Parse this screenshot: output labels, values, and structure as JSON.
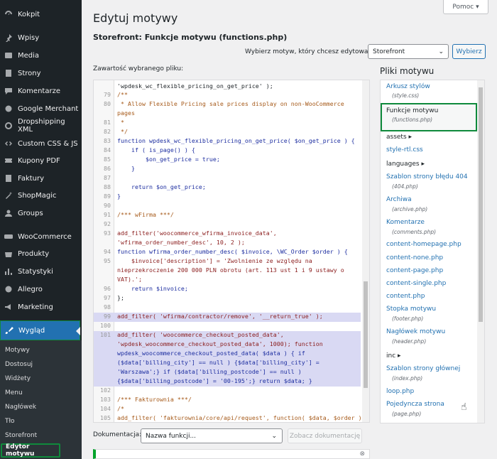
{
  "sidebar": {
    "items": [
      {
        "label": "Kokpit",
        "icon": "dashboard-icon"
      },
      {
        "label": "Wpisy",
        "icon": "pin-icon"
      },
      {
        "label": "Media",
        "icon": "media-icon"
      },
      {
        "label": "Strony",
        "icon": "page-icon"
      },
      {
        "label": "Komentarze",
        "icon": "comment-icon"
      },
      {
        "label": "Google Merchant",
        "icon": "google-merchant-icon"
      },
      {
        "label": "Dropshipping XML",
        "icon": "dropshipping-icon"
      },
      {
        "label": "Custom CSS & JS",
        "icon": "code-icon"
      },
      {
        "label": "Kupony PDF",
        "icon": "coupon-icon"
      },
      {
        "label": "Faktury",
        "icon": "invoice-icon"
      },
      {
        "label": "ShopMagic",
        "icon": "magic-icon"
      },
      {
        "label": "Groups",
        "icon": "groups-icon"
      },
      {
        "label": "WooCommerce",
        "icon": "woocommerce-icon"
      },
      {
        "label": "Produkty",
        "icon": "product-icon"
      },
      {
        "label": "Statystyki",
        "icon": "stats-icon"
      },
      {
        "label": "Allegro",
        "icon": "allegro-icon"
      },
      {
        "label": "Marketing",
        "icon": "marketing-icon"
      }
    ],
    "active": {
      "label": "Wygląd",
      "icon": "brush-icon"
    },
    "submenu": [
      "Motywy",
      "Dostosuj",
      "Widżety",
      "Menu",
      "Nagłówek",
      "Tło",
      "Storefront"
    ],
    "submenu_active": "Edytor motywu"
  },
  "header": {
    "help": "Pomoc",
    "title": "Edytuj motywy",
    "subtitle": "Storefront: Funkcje motywu (functions.php)",
    "choose_label": "Wybierz motyw, który chcesz edytować:",
    "theme_value": "Storefront",
    "choose_button": "Wybierz",
    "file_label": "Zawartość wybranego pliku:"
  },
  "editor": {
    "lines": [
      {
        "num": "",
        "code": "'wpdesk_wc_flexible_pricing_on_get_price' );"
      },
      {
        "num": "79",
        "code": "/**"
      },
      {
        "num": "80",
        "code": " * Allow Flexible Pricing sale prices display on non-WooCommerce"
      },
      {
        "num": "",
        "code": "pages"
      },
      {
        "num": "81",
        "code": " *"
      },
      {
        "num": "82",
        "code": " */"
      },
      {
        "num": "83",
        "code": "function wpdesk_wc_flexible_pricing_on_get_price( $on_get_price ) {"
      },
      {
        "num": "84",
        "code": "    if ( is_page() ) {"
      },
      {
        "num": "85",
        "code": "        $on_get_price = true;"
      },
      {
        "num": "86",
        "code": "    }"
      },
      {
        "num": "87",
        "code": ""
      },
      {
        "num": "88",
        "code": "    return $on_get_price;"
      },
      {
        "num": "89",
        "code": "}"
      },
      {
        "num": "90",
        "code": ""
      },
      {
        "num": "91",
        "code": "/*** wFirma ***/"
      },
      {
        "num": "92",
        "code": ""
      },
      {
        "num": "93",
        "code": "add_filter('woocommerce_wfirma_invoice_data',"
      },
      {
        "num": "",
        "code": "'wfirma_order_number_desc', 10, 2 );"
      },
      {
        "num": "94",
        "code": "function wfirma_order_number_desc( $invoice, \\WC_Order $order ) {"
      },
      {
        "num": "95",
        "code": "    $invoice['description'] = 'Zwolnienie ze względu na"
      },
      {
        "num": "",
        "code": "nieprzekroczenie 200 000 PLN obrotu (art. 113 ust 1 i 9 ustawy o"
      },
      {
        "num": "",
        "code": "VAT).';"
      },
      {
        "num": "96",
        "code": "    return $invoice;"
      },
      {
        "num": "97",
        "code": "};"
      },
      {
        "num": "98",
        "code": ""
      },
      {
        "num": "99",
        "code": "add_filter( 'wfirma/contractor/remove', '__return_true' );"
      },
      {
        "num": "100",
        "code": ""
      },
      {
        "num": "101",
        "code": "add_filter( 'woocommerce_checkout_posted_data',"
      },
      {
        "num": "",
        "code": "'wpdesk_woocommerce_checkout_posted_data', 1000); function"
      },
      {
        "num": "",
        "code": "wpdesk_woocommerce_checkout_posted_data( $data ) { if"
      },
      {
        "num": "",
        "code": "($data['billing_city'] == null ) {$data['billing_city'] ="
      },
      {
        "num": "",
        "code": "'Warszawa';} if ($data['billing_postcode'] == null )"
      },
      {
        "num": "",
        "code": "{$data['billing_postcode'] = '00-195';} return $data; }"
      },
      {
        "num": "102",
        "code": ""
      },
      {
        "num": "103",
        "code": "/*** Fakturownia ***/"
      },
      {
        "num": "104",
        "code": "/*"
      },
      {
        "num": "105",
        "code": "add_filter( 'fakturownia/core/api/request', function( $data, $order )"
      }
    ]
  },
  "files": {
    "title": "Pliki motywu",
    "items": [
      {
        "kind": "file",
        "label": "Arkusz stylów",
        "sub": "(style.css)"
      },
      {
        "kind": "file",
        "label": "Funkcje motywu",
        "sub": "(functions.php)"
      },
      {
        "kind": "folder",
        "label": "assets ▸"
      },
      {
        "kind": "file",
        "label": "style-rtl.css"
      },
      {
        "kind": "folder",
        "label": "languages ▸"
      },
      {
        "kind": "file",
        "label": "Szablon strony błędu 404",
        "sub": "(404.php)"
      },
      {
        "kind": "file",
        "label": "Archiwa",
        "sub": "(archive.php)"
      },
      {
        "kind": "file",
        "label": "Komentarze",
        "sub": "(comments.php)"
      },
      {
        "kind": "file",
        "label": "content-homepage.php"
      },
      {
        "kind": "file",
        "label": "content-none.php"
      },
      {
        "kind": "file",
        "label": "content-page.php"
      },
      {
        "kind": "file",
        "label": "content-single.php"
      },
      {
        "kind": "file",
        "label": "content.php"
      },
      {
        "kind": "file",
        "label": "Stopka motywu",
        "sub": "(footer.php)"
      },
      {
        "kind": "file",
        "label": "Nagłówek motywu",
        "sub": "(header.php)"
      },
      {
        "kind": "folder",
        "label": "inc ▸"
      },
      {
        "kind": "file",
        "label": "Szablon strony głównej",
        "sub": "(index.php)"
      },
      {
        "kind": "file",
        "label": "loop.php"
      },
      {
        "kind": "file",
        "label": "Pojedyncza strona",
        "sub": "(page.php)"
      }
    ]
  },
  "footer": {
    "doc_label": "Dokumentacja:",
    "doc_placeholder": "Nazwa funkcji...",
    "doc_button": "Zobacz dokumentację"
  },
  "colors": {
    "accent": "#2271b1",
    "highlight_border": "#0f8a3c",
    "sidebar_bg": "#1d2327"
  }
}
